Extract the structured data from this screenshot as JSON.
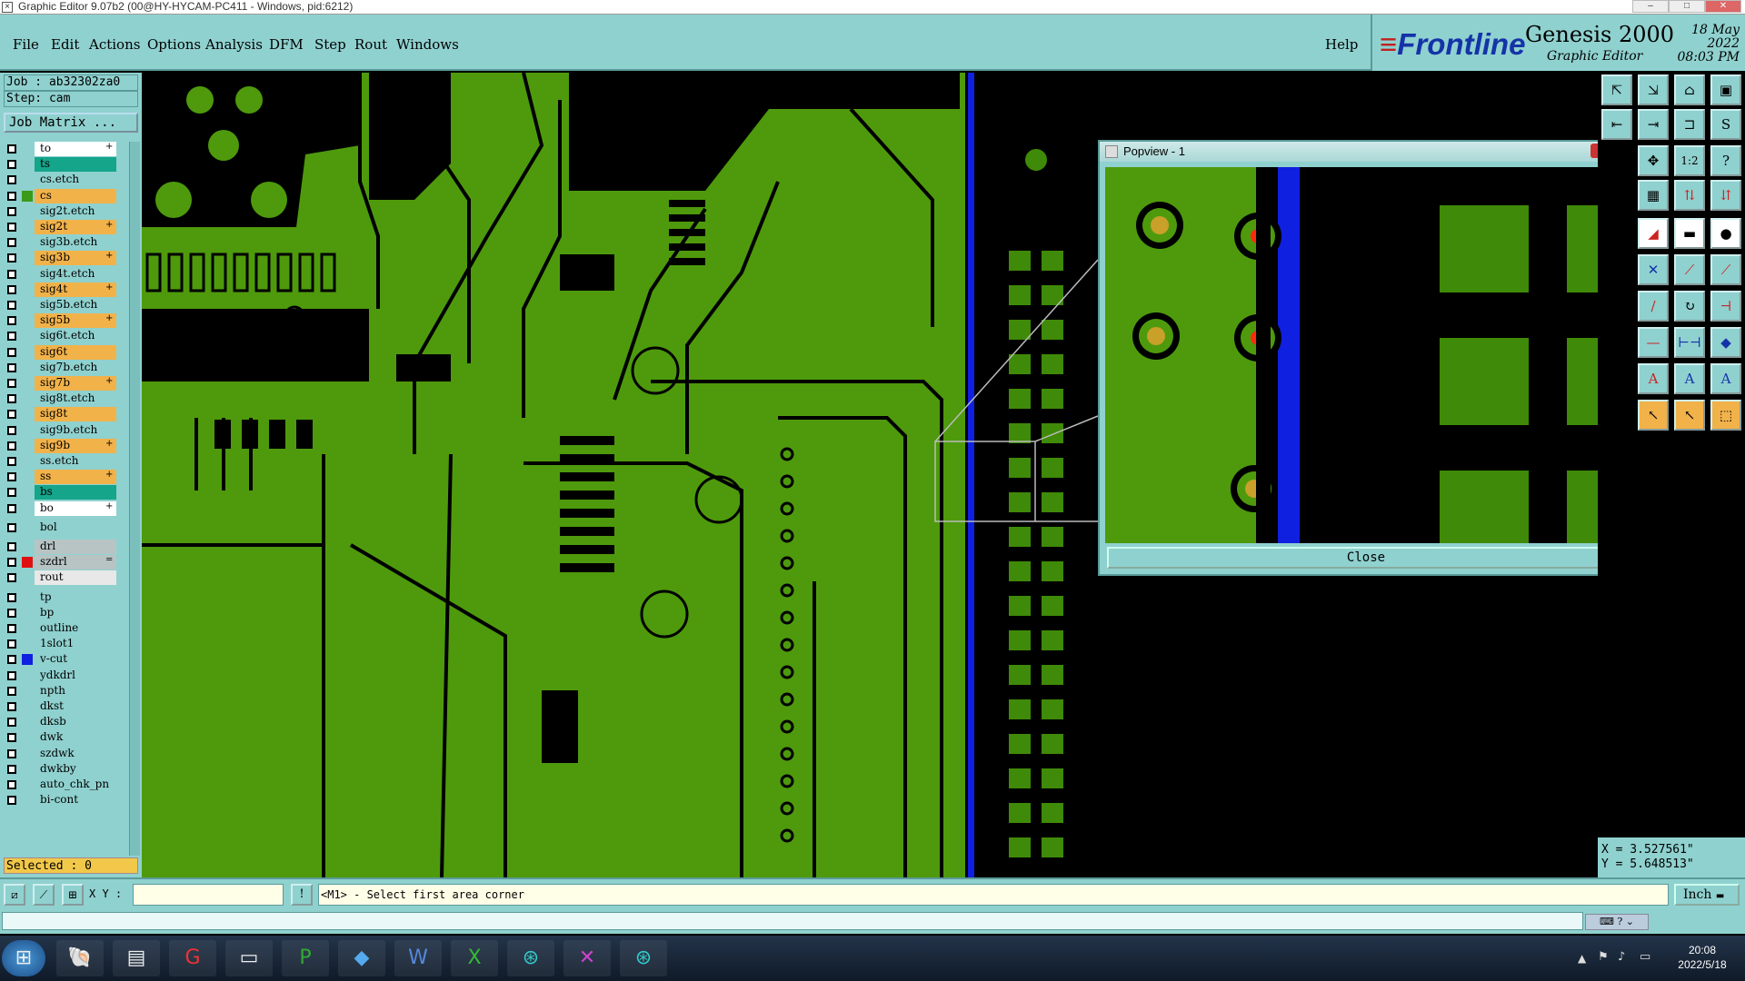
{
  "window": {
    "title": "Graphic Editor 9.07b2 (00@HY-HYCAM-PC411 - Windows, pid:6212)"
  },
  "menu": {
    "items": [
      "File",
      "Edit",
      "Actions",
      "Options",
      "Analysis",
      "DFM",
      "Step",
      "Rout",
      "Windows"
    ],
    "help": "Help"
  },
  "brand": {
    "logo_main": "Frontline",
    "product": "Genesis 2000",
    "subtitle": "Graphic Editor",
    "date": "18 May 2022",
    "time": "08:03 PM"
  },
  "job": {
    "job_line": "Job : ab32302za0",
    "step_line": "Step: cam",
    "matrix_button": "Job Matrix ..."
  },
  "layers": [
    {
      "name": "to",
      "color": "#ffffff",
      "flag": "+"
    },
    {
      "name": "ts",
      "color": "#14a58a",
      "flag": ""
    },
    {
      "name": "cs.etch",
      "color": "#8fd1cf",
      "flag": ""
    },
    {
      "name": "cs",
      "color": "#f2b24a",
      "flag": "",
      "active": true
    },
    {
      "name": "sig2t.etch",
      "color": "#8fd1cf",
      "flag": ""
    },
    {
      "name": "sig2t",
      "color": "#f2b24a",
      "flag": "+"
    },
    {
      "name": "sig3b.etch",
      "color": "#8fd1cf",
      "flag": ""
    },
    {
      "name": "sig3b",
      "color": "#f2b24a",
      "flag": "+"
    },
    {
      "name": "sig4t.etch",
      "color": "#8fd1cf",
      "flag": ""
    },
    {
      "name": "sig4t",
      "color": "#f2b24a",
      "flag": "+"
    },
    {
      "name": "sig5b.etch",
      "color": "#8fd1cf",
      "flag": ""
    },
    {
      "name": "sig5b",
      "color": "#f2b24a",
      "flag": "+"
    },
    {
      "name": "sig6t.etch",
      "color": "#8fd1cf",
      "flag": ""
    },
    {
      "name": "sig6t",
      "color": "#f2b24a",
      "flag": ""
    },
    {
      "name": "sig7b.etch",
      "color": "#8fd1cf",
      "flag": ""
    },
    {
      "name": "sig7b",
      "color": "#f2b24a",
      "flag": "+"
    },
    {
      "name": "sig8t.etch",
      "color": "#8fd1cf",
      "flag": ""
    },
    {
      "name": "sig8t",
      "color": "#f2b24a",
      "flag": ""
    },
    {
      "name": "sig9b.etch",
      "color": "#8fd1cf",
      "flag": ""
    },
    {
      "name": "sig9b",
      "color": "#f2b24a",
      "flag": "+"
    },
    {
      "name": "ss.etch",
      "color": "#8fd1cf",
      "flag": ""
    },
    {
      "name": "ss",
      "color": "#f2b24a",
      "flag": "+"
    },
    {
      "name": "bs",
      "color": "#14a58a",
      "flag": ""
    },
    {
      "name": "bo",
      "color": "#ffffff",
      "flag": "+"
    },
    {
      "name": "bol",
      "color": "#8fd1cf",
      "flag": ""
    },
    {
      "name": "drl",
      "color": "#b8c4c4",
      "flag": ""
    },
    {
      "name": "szdrl",
      "color": "#b8c4c4",
      "flag": "=",
      "swatch": "#e01010"
    },
    {
      "name": "rout",
      "color": "#e8e8e8",
      "flag": ""
    },
    {
      "name": "tp",
      "color": "#8fd1cf",
      "flag": ""
    },
    {
      "name": "bp",
      "color": "#8fd1cf",
      "flag": ""
    },
    {
      "name": "outline",
      "color": "#8fd1cf",
      "flag": ""
    },
    {
      "name": "1slot1",
      "color": "#8fd1cf",
      "flag": ""
    },
    {
      "name": "v-cut",
      "color": "#8fd1cf",
      "flag": "",
      "swatch": "#1020e0"
    },
    {
      "name": "ydkdrl",
      "color": "#8fd1cf",
      "flag": ""
    },
    {
      "name": "npth",
      "color": "#8fd1cf",
      "flag": ""
    },
    {
      "name": "dkst",
      "color": "#8fd1cf",
      "flag": ""
    },
    {
      "name": "dksb",
      "color": "#8fd1cf",
      "flag": ""
    },
    {
      "name": "dwk",
      "color": "#8fd1cf",
      "flag": ""
    },
    {
      "name": "szdwk",
      "color": "#8fd1cf",
      "flag": ""
    },
    {
      "name": "dwkby",
      "color": "#8fd1cf",
      "flag": ""
    },
    {
      "name": "auto_chk_pn",
      "color": "#8fd1cf",
      "flag": ""
    },
    {
      "name": "bi-cont",
      "color": "#8fd1cf",
      "flag": ""
    }
  ],
  "selected": "Selected : 0",
  "popview": {
    "title": "Popview - 1",
    "close_button": "Close",
    "x_icon": "✕"
  },
  "coords": {
    "x": "X = 3.527561\"",
    "y": "Y = 5.648513\""
  },
  "status": {
    "xy_label": "X Y :",
    "prompt": "<M1> - Select first area corner",
    "unit": "Inch"
  },
  "taskbar": {
    "time": "20:08",
    "date": "2022/5/18"
  },
  "colors": {
    "panel": "#8fd1cf",
    "copper": "#4e9a0c",
    "vcut": "#1020e0",
    "pad": "#3f8a08"
  }
}
